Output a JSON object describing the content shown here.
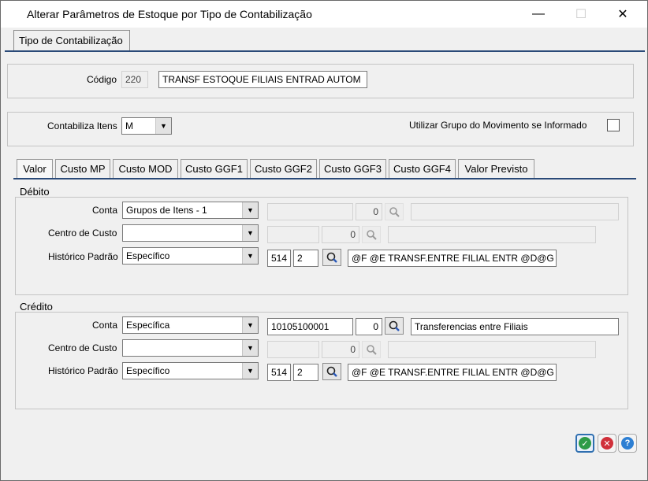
{
  "window": {
    "title": "Alterar Parâmetros de Estoque por Tipo de Contabilização",
    "minimize": "—",
    "maximize": "☐",
    "close": "✕"
  },
  "outer_tab": {
    "label": "Tipo de Contabilização"
  },
  "header": {
    "codigo_label": "Código",
    "codigo_value": "220",
    "descricao_value": "TRANSF ESTOQUE FILIAIS ENTRAD AUTOM"
  },
  "options": {
    "contabiliza_label": "Contabiliza Itens",
    "contabiliza_value": "M",
    "utilizar_grupo_label": "Utilizar Grupo do Movimento se Informado",
    "utilizar_grupo_checked": false
  },
  "tabs": [
    "Valor",
    "Custo MP",
    "Custo MOD",
    "Custo GGF1",
    "Custo GGF2",
    "Custo GGF3",
    "Custo GGF4",
    "Valor Previsto"
  ],
  "debito": {
    "title": "Débito",
    "conta_label": "Conta",
    "conta_value": "Grupos de Itens - 1",
    "conta_code": "",
    "conta_num": "0",
    "conta_desc": "",
    "cc_label": "Centro de Custo",
    "cc_value": "",
    "cc_code": "",
    "cc_num": "0",
    "cc_desc": "",
    "hist_label": "Histórico Padrão",
    "hist_value": "Específico",
    "hist_code": "514",
    "hist_num": "2",
    "hist_desc": "@F @E TRANSF.ENTRE FILIAL ENTR @D@G"
  },
  "credito": {
    "title": "Crédito",
    "conta_label": "Conta",
    "conta_value": "Específica",
    "conta_code": "10105100001",
    "conta_num": "0",
    "conta_desc": "Transferencias entre Filiais",
    "cc_label": "Centro de Custo",
    "cc_value": "",
    "cc_code": "",
    "cc_num": "0",
    "cc_desc": "",
    "hist_label": "Histórico Padrão",
    "hist_value": "Específico",
    "hist_code": "514",
    "hist_num": "2",
    "hist_desc": "@F @E TRANSF.ENTRE FILIAL ENTR @D@G"
  },
  "footer": {
    "ok_icon": "✓",
    "cancel_icon": "✕",
    "help_icon": "?"
  },
  "colors": {
    "accent": "#2a4a78",
    "ok": "#2e9b47",
    "cancel": "#d0303a",
    "help": "#2d7fd3"
  }
}
